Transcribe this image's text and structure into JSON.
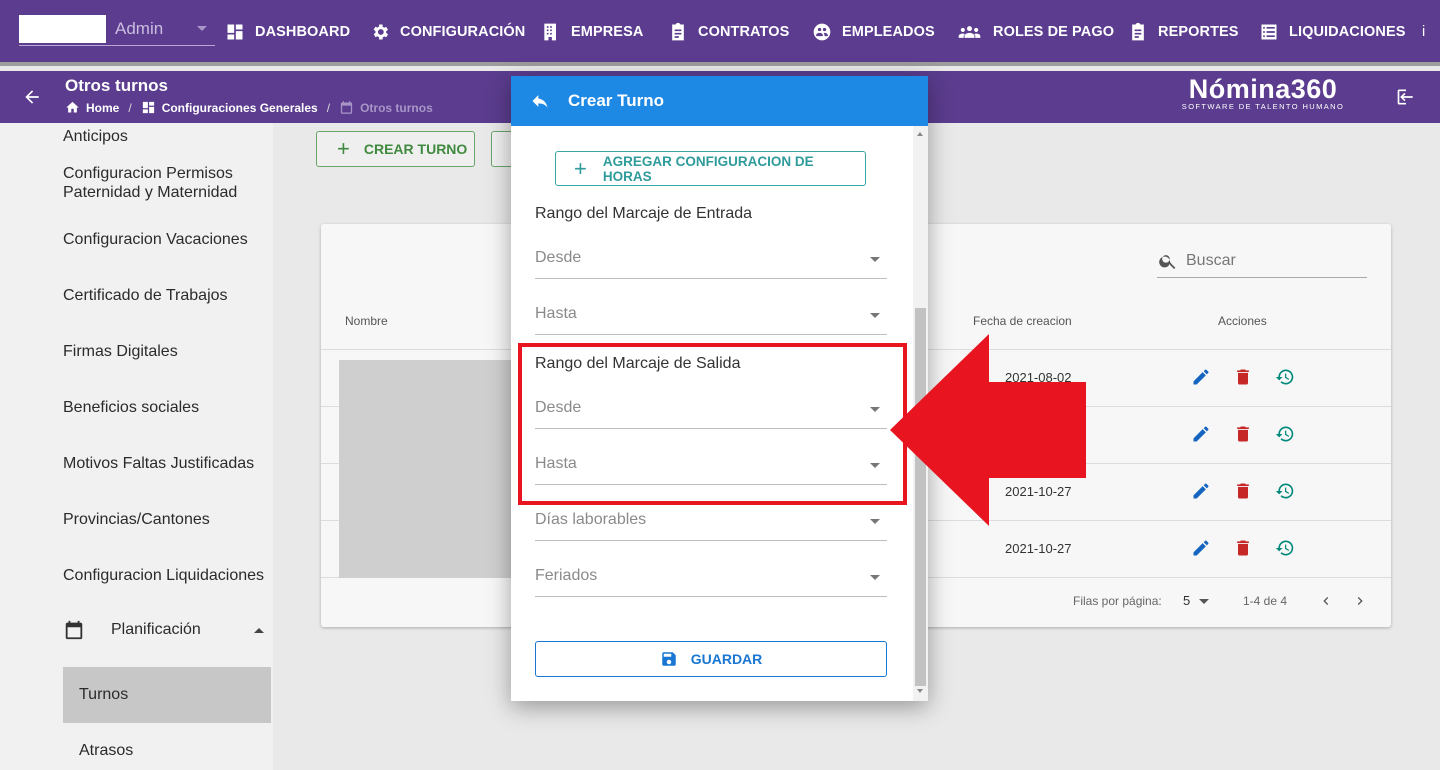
{
  "topnav": {
    "admin_label": "Admin",
    "items": [
      {
        "label": "DASHBOARD",
        "icon": "dashboard-icon"
      },
      {
        "label": "CONFIGURACIÓN",
        "icon": "gear-icon"
      },
      {
        "label": "EMPRESA",
        "icon": "building-icon"
      },
      {
        "label": "CONTRATOS",
        "icon": "clipboard-icon"
      },
      {
        "label": "EMPLEADOS",
        "icon": "people-circle-icon"
      },
      {
        "label": "ROLES DE PAGO",
        "icon": "group-icon"
      },
      {
        "label": "REPORTES",
        "icon": "report-icon"
      },
      {
        "label": "LIQUIDACIONES",
        "icon": "list-icon"
      }
    ]
  },
  "subheader": {
    "title": "Otros turnos",
    "breadcrumbs": [
      "Home",
      "Configuraciones Generales",
      "Otros turnos"
    ],
    "brand_name": "Nómina360",
    "brand_tagline": "SOFTWARE DE TALENTO HUMANO"
  },
  "sidebar": {
    "items": [
      "Anticipos",
      "Configuracion Permisos Paternidad y Maternidad",
      "Configuracion Vacaciones",
      "Certificado de Trabajos",
      "Firmas Digitales",
      "Beneficios sociales",
      "Motivos Faltas Justificadas",
      "Provincias/Cantones",
      "Configuracion Liquidaciones"
    ],
    "group_label": "Planificación",
    "selected_item": "Turnos",
    "sub_item": "Atrasos"
  },
  "toolbar": {
    "create_label": "CREAR TURNO"
  },
  "table": {
    "search_placeholder": "Buscar",
    "columns": [
      "Nombre",
      "Fecha de creacion",
      "Acciones"
    ],
    "rows": [
      {
        "date": "2021-08-02"
      },
      {
        "date": ""
      },
      {
        "date": "2021-10-27"
      },
      {
        "date": "2021-10-27"
      }
    ],
    "rows_per_page_label": "Filas por página:",
    "rows_per_page": "5",
    "range": "1-4 de 4"
  },
  "dialog": {
    "title": "Crear Turno",
    "add_config_label": "AGREGAR CONFIGURACION DE HORAS",
    "entrada_label": "Rango del Marcaje de Entrada",
    "salida_label": "Rango del Marcaje de Salida",
    "desde": "Desde",
    "hasta": "Hasta",
    "dias": "Días laborables",
    "feriados": "Feriados",
    "save_label": "GUARDAR"
  },
  "colors": {
    "nav": "#5b3c8e",
    "dialog_header": "#1e88e5",
    "highlight": "#e8141f",
    "edit": "#1565c0",
    "delete": "#c62828",
    "history": "#00897b"
  }
}
